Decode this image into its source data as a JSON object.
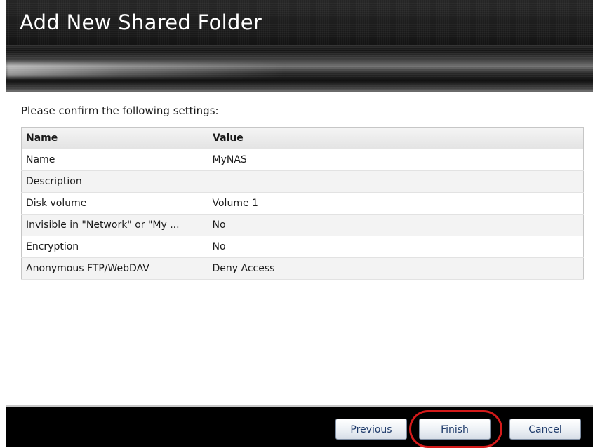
{
  "window": {
    "title": "Add New Shared Folder"
  },
  "content": {
    "prompt": "Please confirm the following settings:",
    "table": {
      "headers": [
        "Name",
        "Value"
      ],
      "rows": [
        {
          "name": "Name",
          "value": "MyNAS"
        },
        {
          "name": "Description",
          "value": ""
        },
        {
          "name": "Disk volume",
          "value": "Volume 1"
        },
        {
          "name": "Invisible in \"Network\" or \"My ...",
          "value": "No"
        },
        {
          "name": "Encryption",
          "value": "No"
        },
        {
          "name": "Anonymous FTP/WebDAV",
          "value": "Deny Access"
        }
      ]
    }
  },
  "footer": {
    "previous_label": "Previous",
    "finish_label": "Finish",
    "cancel_label": "Cancel"
  },
  "colors": {
    "highlight": "#d41a1a",
    "button_text": "#1f3b6b"
  }
}
